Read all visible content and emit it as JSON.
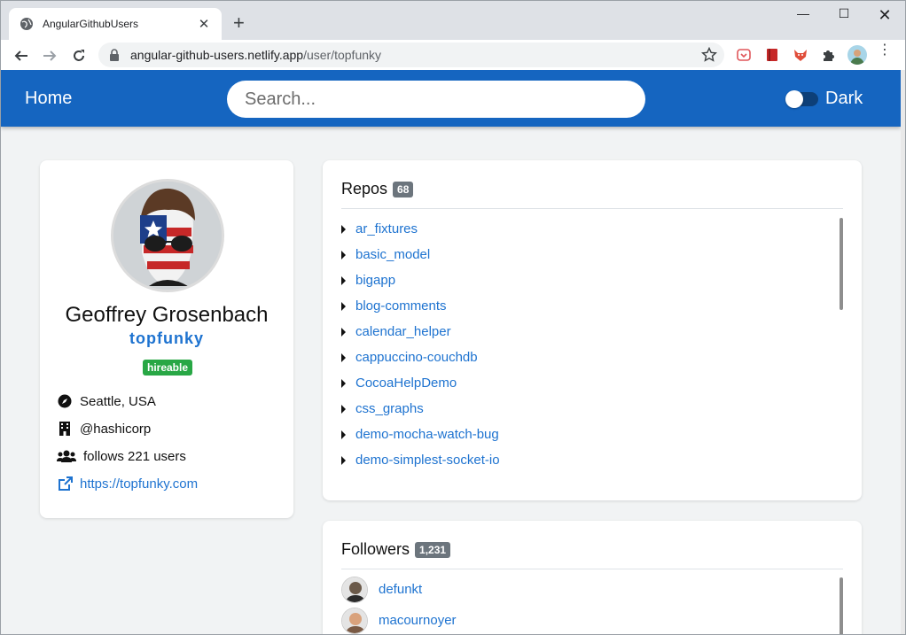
{
  "browser": {
    "tab_title": "AngularGithubUsers",
    "url_host": "angular-github-users.netlify.app",
    "url_path": "/user/topfunky"
  },
  "appbar": {
    "home_label": "Home",
    "search_placeholder": "Search...",
    "dark_label": "Dark",
    "dark_enabled": false
  },
  "profile": {
    "name": "Geoffrey Grosenbach",
    "login": "topfunky",
    "badge": "hireable",
    "location": "Seattle, USA",
    "company": "@hashicorp",
    "following": "follows 221 users",
    "blog": "https://topfunky.com"
  },
  "repos": {
    "title": "Repos",
    "count": "68",
    "items": [
      "ar_fixtures",
      "basic_model",
      "bigapp",
      "blog-comments",
      "calendar_helper",
      "cappuccino-couchdb",
      "CocoaHelpDemo",
      "css_graphs",
      "demo-mocha-watch-bug",
      "demo-simplest-socket-io"
    ]
  },
  "followers": {
    "title": "Followers",
    "count": "1,231",
    "items": [
      "defunkt",
      "macournoyer"
    ]
  },
  "colors": {
    "appbar": "#1565c0",
    "link": "#1e73d0",
    "hireable": "#28a745",
    "badge": "#6c757d"
  }
}
